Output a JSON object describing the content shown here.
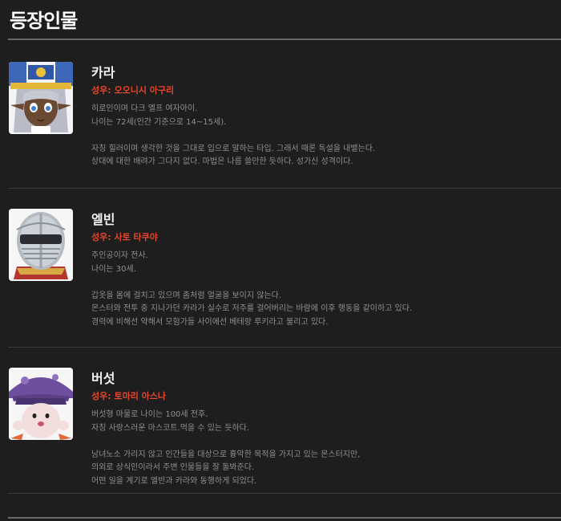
{
  "section": {
    "title": "등장인물"
  },
  "characters": [
    {
      "name": "카라",
      "voice_actor": "성우: 오오니시 아구리",
      "lines": [
        "히로인이며 다크 엘프 여자아이.",
        "나이는 72세(인간 기준으로 14~15세).",
        "",
        "자칭 힐러이며 생각한 것을 그대로 입으로 말하는 타입. 그래서 때론 독설을 내뱉는다.",
        "상대에 대한 배려가 그다지 없다. 마법은 나름 쓸만한 듯하다. 성가신 성격이다."
      ]
    },
    {
      "name": "엘빈",
      "voice_actor": "성우: 사토 타쿠야",
      "lines": [
        "주인공이자 전사.",
        "나이는 30세.",
        "",
        "갑옷을 몸에 걸치고 있으며 좀처럼 얼굴을 보이지 않는다.",
        "몬스터와 전투 중 지나가던 카라가 실수로 저주를 걸어버리는 바람에 이후 행동을 같이하고 있다.",
        "경력에 비해선 약해서 모험가들 사이에선 베테랑 루키라고 불리고 있다."
      ]
    },
    {
      "name": "버섯",
      "voice_actor": "성우: 토마리 아스나",
      "lines": [
        "버섯형 마물로 나이는 100세 전후.",
        "자칭 사랑스러운 마스코트.먹을 수 있는 듯하다.",
        "",
        "남녀노소 가리지 않고 인간들을 대상으로 흉악한 목적을 가지고 있는 몬스터지만,",
        "의외로 상식인이라서 주변 인물들을 잘 돌봐준다.",
        "어떤 일을 계기로 엘빈과 카라와 동행하게 되었다."
      ]
    }
  ]
}
